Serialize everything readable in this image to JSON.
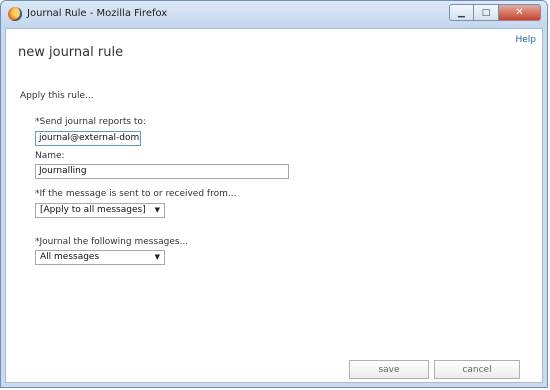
{
  "window": {
    "title": "Journal Rule - Mozilla Firefox",
    "minimize_glyph": "▁",
    "maximize_glyph": "□",
    "close_glyph": "✕"
  },
  "header": {
    "help_label": "Help",
    "page_title": "new journal rule"
  },
  "form": {
    "intro": "Apply this rule...",
    "send_reports": {
      "label": "*Send journal reports to:",
      "value": "journal@external-domair"
    },
    "name": {
      "label": "Name:",
      "value": "Journalling"
    },
    "sent_or_received": {
      "label": "*If the message is sent to or received from...",
      "selected": "[Apply to all messages]"
    },
    "journal_messages": {
      "label": "*Journal the following messages...",
      "selected": "All messages"
    }
  },
  "footer": {
    "save_label": "save",
    "cancel_label": "cancel"
  },
  "icons": {
    "app": "firefox-icon",
    "dropdown": "chevron-down-icon"
  }
}
